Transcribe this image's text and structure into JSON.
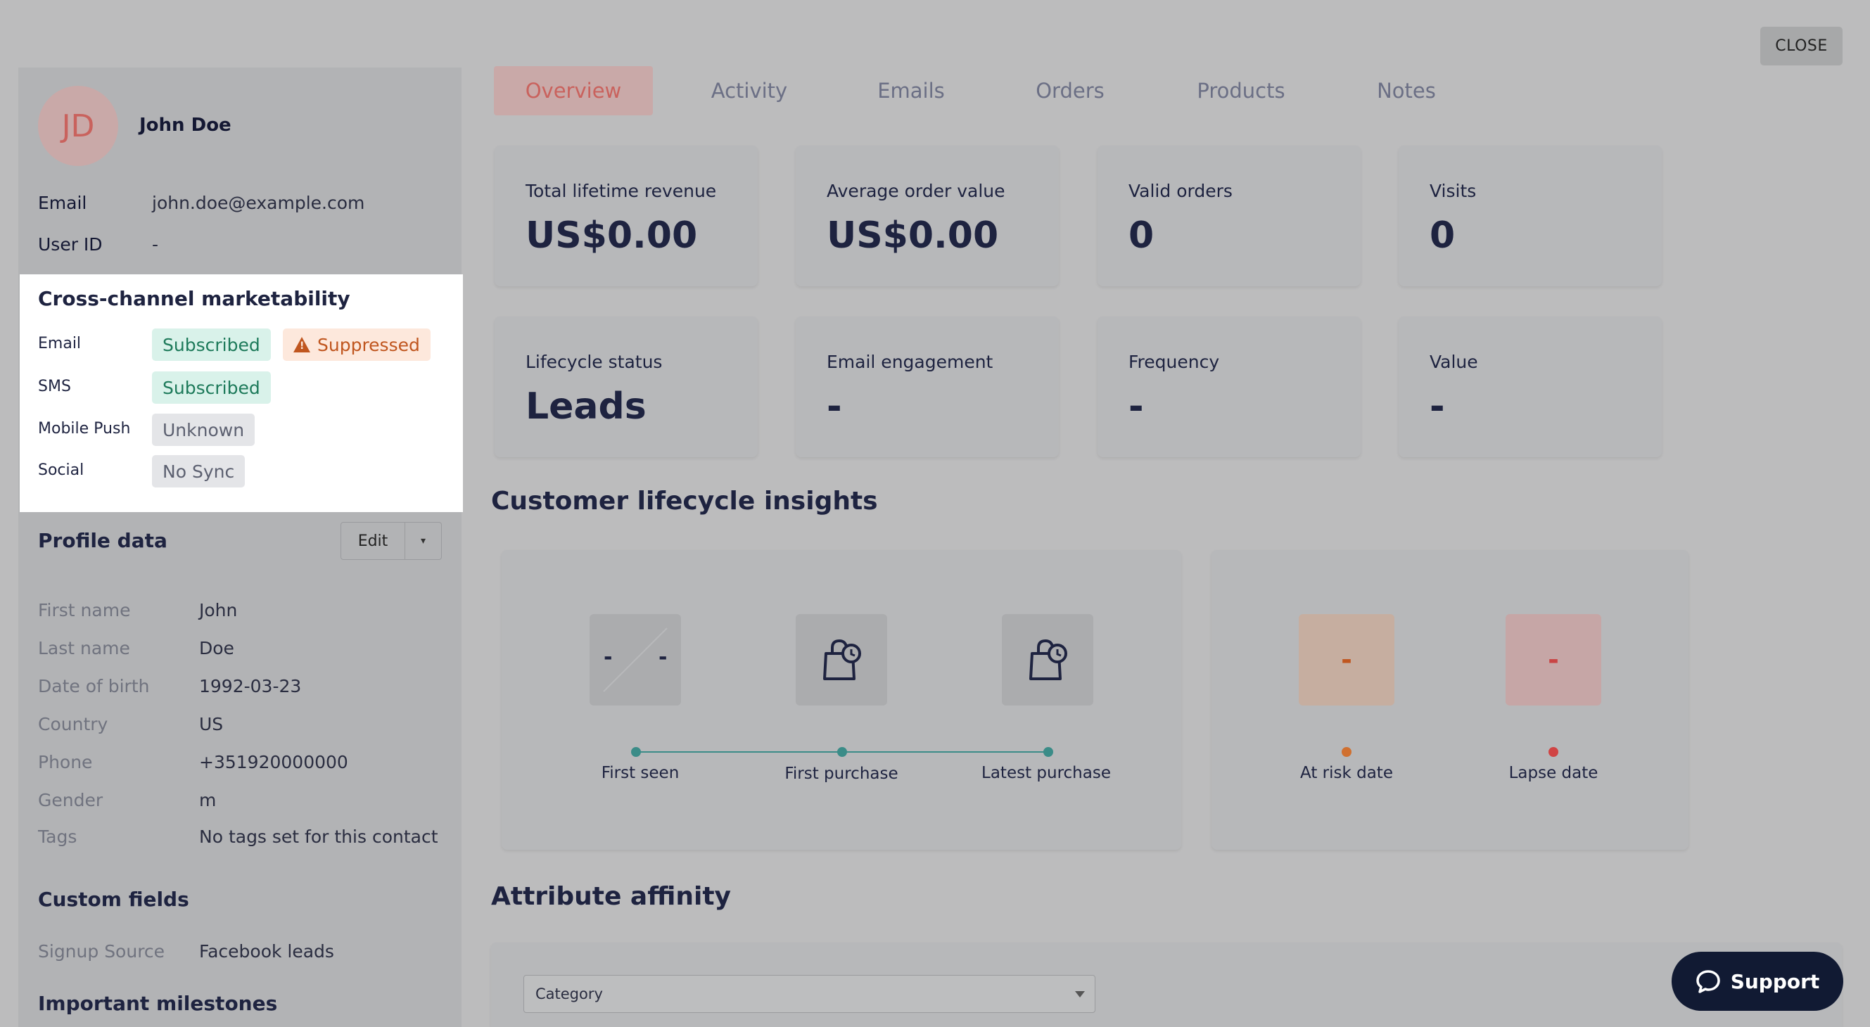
{
  "close_label": "CLOSE",
  "profile": {
    "initials": "JD",
    "name": "John Doe",
    "email_label": "Email",
    "email_value": "john.doe@example.com",
    "user_id_label": "User ID",
    "user_id_value": "-"
  },
  "marketability": {
    "title": "Cross-channel marketability",
    "rows": [
      {
        "label": "Email",
        "badges": [
          "Subscribed",
          "Suppressed"
        ]
      },
      {
        "label": "SMS",
        "badges": [
          "Subscribed"
        ]
      },
      {
        "label": "Mobile Push",
        "badges": [
          "Unknown"
        ]
      },
      {
        "label": "Social",
        "badges": [
          "No Sync"
        ]
      }
    ]
  },
  "profile_data": {
    "title": "Profile data",
    "edit_label": "Edit",
    "caret": "▾",
    "fields": [
      {
        "label": "First name",
        "value": "John"
      },
      {
        "label": "Last name",
        "value": "Doe"
      },
      {
        "label": "Date of birth",
        "value": "1992-03-23"
      },
      {
        "label": "Country",
        "value": "US"
      },
      {
        "label": "Phone",
        "value": "+351920000000"
      },
      {
        "label": "Gender",
        "value": "m"
      },
      {
        "label": "Tags",
        "value": "No tags set for this contact"
      }
    ]
  },
  "custom_fields": {
    "title": "Custom fields",
    "fields": [
      {
        "label": "Signup Source",
        "value": "Facebook leads"
      }
    ]
  },
  "milestones_title": "Important milestones",
  "tabs": [
    "Overview",
    "Activity",
    "Emails",
    "Orders",
    "Products",
    "Notes"
  ],
  "stats": [
    {
      "label": "Total lifetime revenue",
      "value": "US$0.00"
    },
    {
      "label": "Average order value",
      "value": "US$0.00"
    },
    {
      "label": "Valid orders",
      "value": "0"
    },
    {
      "label": "Visits",
      "value": "0"
    },
    {
      "label": "Lifecycle status",
      "value": "Leads"
    },
    {
      "label": "Email engagement",
      "value": "-"
    },
    {
      "label": "Frequency",
      "value": "-"
    },
    {
      "label": "Value",
      "value": "-"
    }
  ],
  "lifecycle": {
    "title": "Customer lifecycle insights",
    "first_seen_value": "-",
    "first_seen_value2": "-",
    "timeline": [
      "First seen",
      "First purchase",
      "Latest purchase"
    ],
    "at_risk_label": "At risk date",
    "at_risk_value": "-",
    "lapse_label": "Lapse date",
    "lapse_value": "-"
  },
  "affinity": {
    "title": "Attribute affinity",
    "select_value": "Category"
  },
  "support_label": "Support",
  "colors": {
    "accent": "#c9625d",
    "teal": "#3b8c88",
    "orange": "#d07030",
    "red": "#d04444",
    "navy": "#111a33"
  }
}
